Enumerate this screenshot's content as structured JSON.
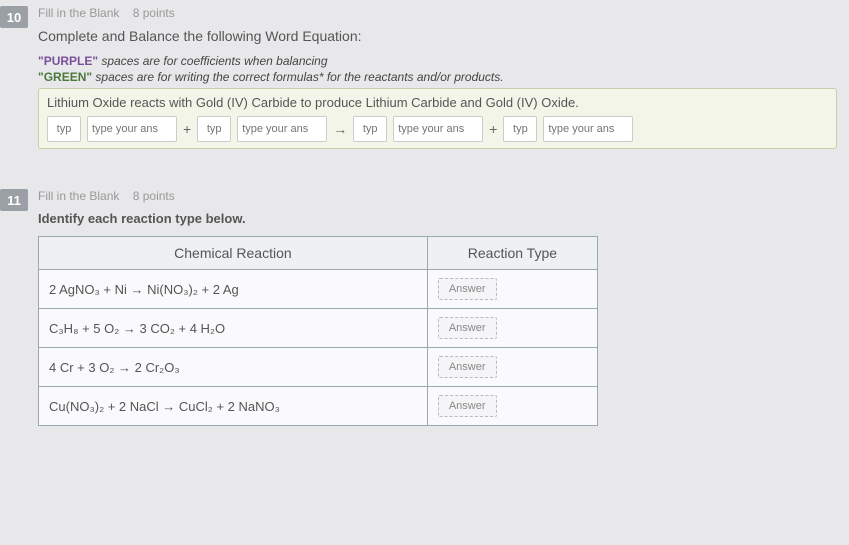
{
  "q10": {
    "number": "10",
    "type": "Fill in the Blank",
    "points": "8 points",
    "prompt": "Complete and Balance the following Word Equation:",
    "hint_purple_label": "\"PURPLE\"",
    "hint_purple_text": " spaces are for coefficients when balancing",
    "hint_green_label": "\"GREEN\"",
    "hint_green_text": " spaces are for writing the correct formulas* for the reactants and/or products.",
    "equation_text": "Lithium Oxide reacts with Gold (IV) Carbide to produce Lithium Carbide and Gold (IV) Oxide.",
    "coef_ph": "typ",
    "form_ph": "type your ans",
    "plus": "+",
    "arrow": "→"
  },
  "q11": {
    "number": "11",
    "type": "Fill in the Blank",
    "points": "8 points",
    "prompt": "Identify each reaction type below.",
    "header_reaction": "Chemical Reaction",
    "header_type": "Reaction Type",
    "answer_label": "Answer",
    "rows": {
      "r1": "2 AgNO₃ + Ni → Ni(NO₃)₂ + 2 Ag",
      "r2": "C₃H₈ + 5 O₂ → 3 CO₂ + 4 H₂O",
      "r3": "4 Cr + 3 O₂ → 2 Cr₂O₃",
      "r4": "Cu(NO₃)₂ + 2 NaCl → CuCl₂ + 2 NaNO₃"
    }
  }
}
